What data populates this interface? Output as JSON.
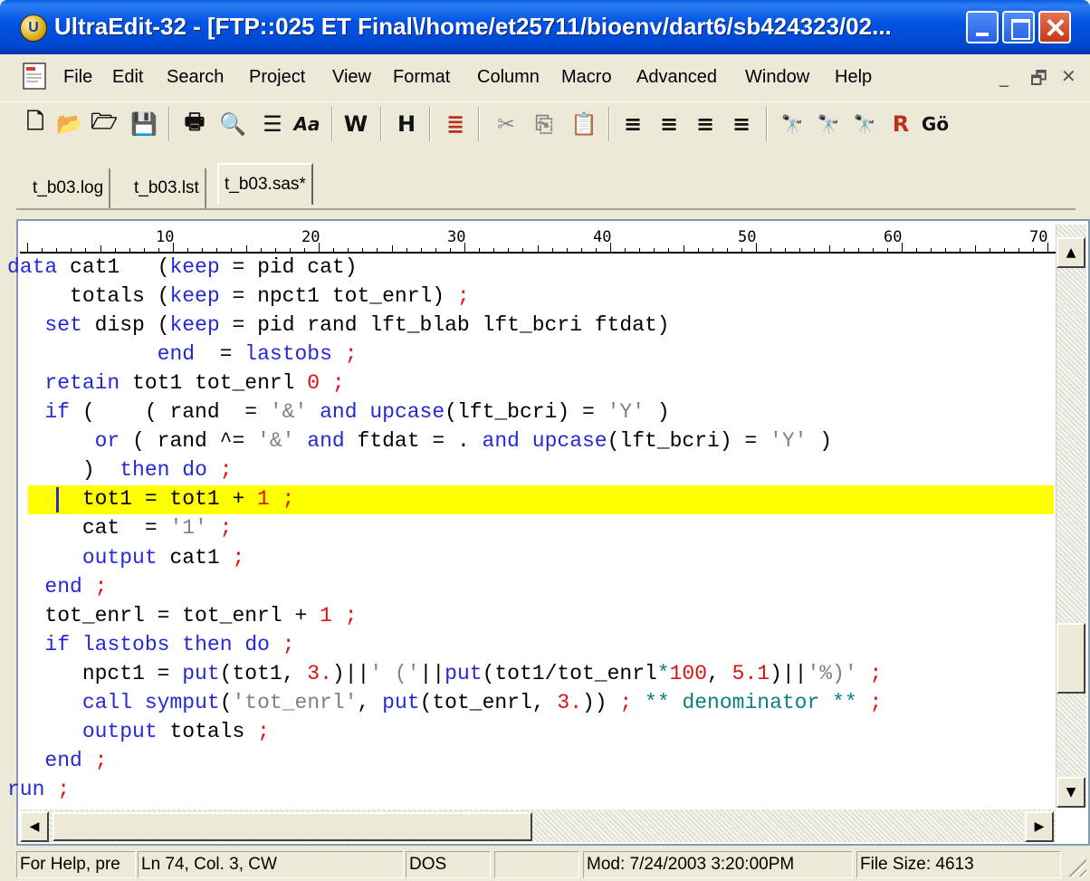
{
  "window": {
    "title": "UltraEdit-32 - [FTP::025 ET Final\\/home/et25711/bioenv/dart6/sb424323/02...",
    "app_icon_letter": "U"
  },
  "menu": {
    "items": [
      "File",
      "Edit",
      "Search",
      "Project",
      "View",
      "Format",
      "Column",
      "Macro",
      "Advanced",
      "Window",
      "Help"
    ],
    "mdi_controls": [
      "_",
      "🗗",
      "✕"
    ]
  },
  "toolbar": {
    "tools": [
      {
        "icon": "new-file-icon",
        "glyph": "🗋"
      },
      {
        "icon": "open-folder-icon",
        "glyph": "📂"
      },
      {
        "icon": "close-file-icon",
        "glyph": "🗁"
      },
      {
        "icon": "save-icon",
        "glyph": "💾"
      },
      {
        "icon": "print-icon",
        "glyph": "🖶"
      },
      {
        "icon": "print-preview-icon",
        "glyph": "🔍"
      },
      {
        "icon": "column-mode-icon",
        "glyph": "☰"
      },
      {
        "icon": "font-icon",
        "glyph": "Aa"
      },
      {
        "icon": "word-wrap-icon",
        "glyph": "W"
      },
      {
        "icon": "hex-mode-icon",
        "glyph": "H"
      },
      {
        "icon": "function-list-icon",
        "glyph": "≣"
      },
      {
        "icon": "cut-icon",
        "glyph": "✂"
      },
      {
        "icon": "copy-icon",
        "glyph": "⎘"
      },
      {
        "icon": "paste-icon",
        "glyph": "📋"
      },
      {
        "icon": "align-left-icon",
        "glyph": "≡"
      },
      {
        "icon": "align-center-icon",
        "glyph": "≡"
      },
      {
        "icon": "align-right-icon",
        "glyph": "≡"
      },
      {
        "icon": "justify-icon",
        "glyph": "≡"
      },
      {
        "icon": "find-icon",
        "glyph": "🔭"
      },
      {
        "icon": "find-next-icon",
        "glyph": "🔭"
      },
      {
        "icon": "find-prev-icon",
        "glyph": "🔭"
      },
      {
        "icon": "replace-icon",
        "glyph": "R"
      },
      {
        "icon": "goto-icon",
        "glyph": "Gö"
      }
    ]
  },
  "tabs": [
    {
      "label": "t_b03.log",
      "active": false
    },
    {
      "label": "t_b03.lst",
      "active": false
    },
    {
      "label": "t_b03.sas*",
      "active": true
    }
  ],
  "ruler": {
    "labels": [
      "10",
      "20",
      "30",
      "40",
      "50",
      "60",
      "70"
    ]
  },
  "editor": {
    "current_line_index": 8,
    "lines": [
      "data cat1   (keep = pid cat)",
      "     totals (keep = npct1 tot_enrl) ;",
      "   set disp (keep = pid rand lft_blab lft_bcri ftdat)",
      "            end  = lastobs ;",
      "   retain tot1 tot_enrl 0 ;",
      "   if (    ( rand  = '&' and upcase(lft_bcri) = 'Y' )",
      "       or ( rand ^= '&' and ftdat = . and upcase(lft_bcri) = 'Y' )",
      "      )  then do ;",
      "      tot1 = tot1 + 1 ;",
      "      cat  = '1' ;",
      "      output cat1 ;",
      "   end ;",
      "   tot_enrl = tot_enrl + 1 ;",
      "   if lastobs then do ;",
      "      npct1 = put(tot1, 3.)||' ('||put(tot1/tot_enrl*100, 5.1)||'%)' ;",
      "      call symput('tot_enrl', put(tot_enrl, 3.)) ; ** denominator ** ;",
      "      output totals ;",
      "   end ;",
      "run ;"
    ]
  },
  "status": {
    "help": "For Help, pre",
    "position": "Ln 74, Col. 3, CW",
    "format": "DOS",
    "blank": "",
    "modified": "Mod: 7/24/2003 3:20:00PM",
    "filesize": "File Size: 4613"
  }
}
